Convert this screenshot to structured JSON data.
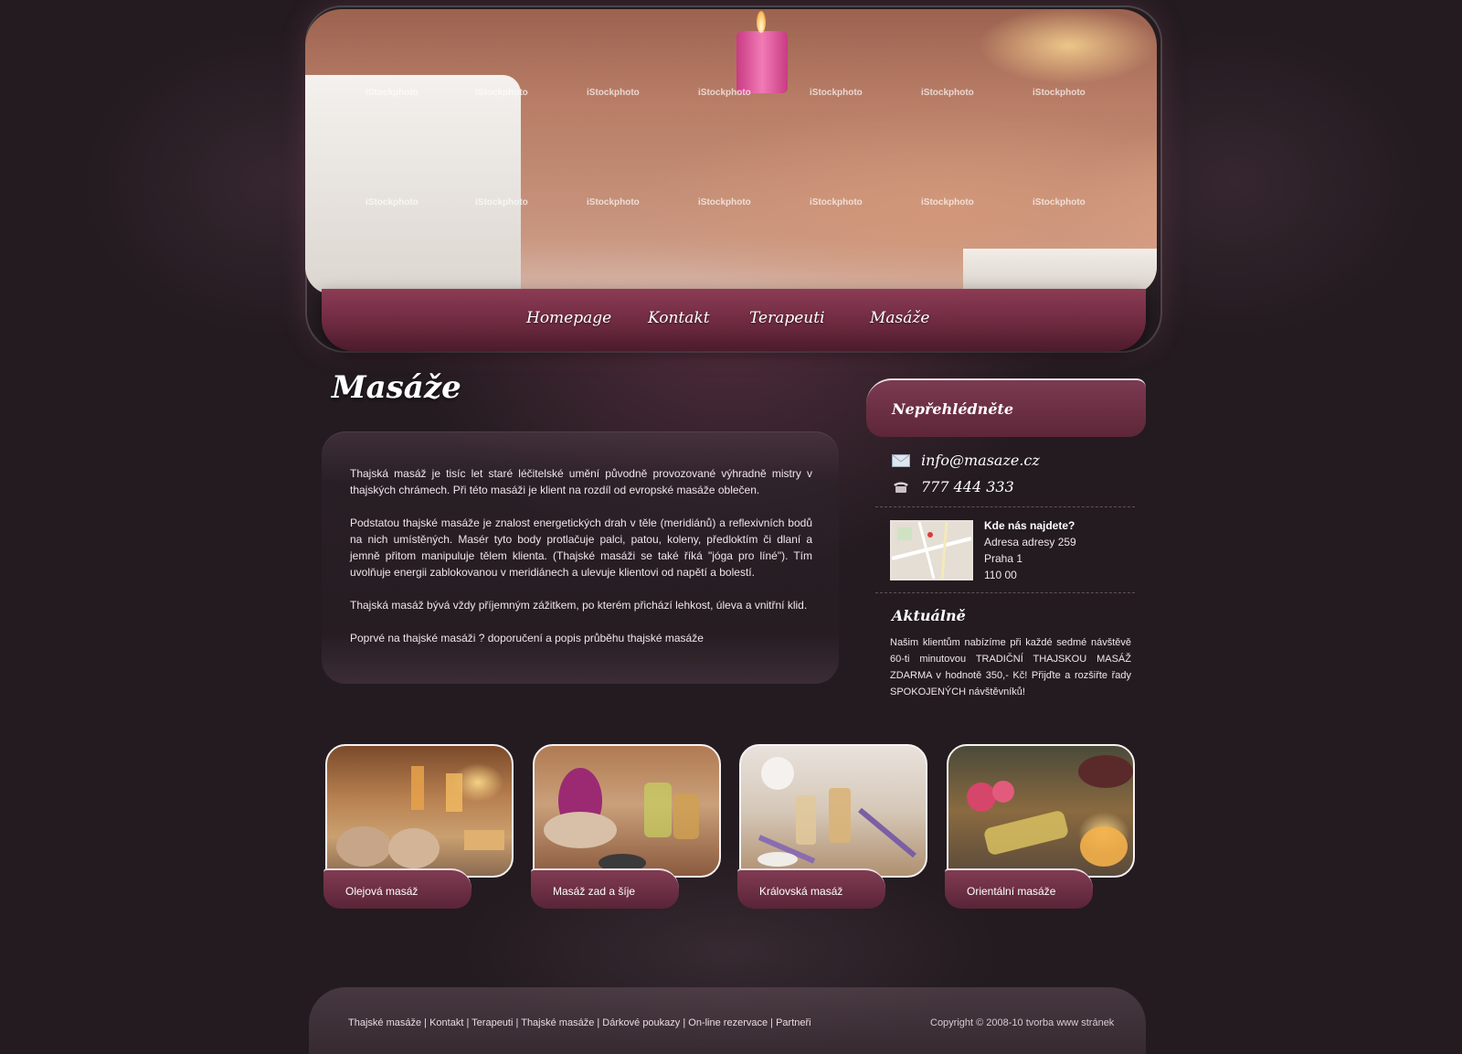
{
  "nav": {
    "items": [
      {
        "label": "Homepage"
      },
      {
        "label": "Kontakt"
      },
      {
        "label": "Terapeuti"
      },
      {
        "label": "Masáže"
      }
    ]
  },
  "hero": {
    "watermark": "iStockphoto"
  },
  "main": {
    "title": "Masáže",
    "paragraphs": [
      "Thajská masáž je tisíc let staré léčitelské umění původně provozované výhradně mistry v thajských chrámech. Při této masáži je klient na rozdíl od evropské masáže oblečen.",
      "Podstatou thajské masáže je znalost energetických drah v těle (meridiánů) a reflexivních bodů na nich umístěných. Masér tyto body protlačuje palci, patou, koleny, předloktím či dlaní a jemně přitom manipuluje tělem klienta. (Thajské masáži se také říká \"jóga pro líné\"). Tím uvolňuje energii zablokovanou v meridiánech a ulevuje klientovi od napětí a bolestí.",
      "Thajská masáž bývá vždy příjemným zážitkem, po kterém přichází lehkost, úleva a vnitřní klid."
    ],
    "link": "Poprvé na thajské masáži ? doporučení a popis průběhu thajské masáže"
  },
  "sidebar": {
    "heading": "Nepřehlédněte",
    "email": "info@masaze.cz",
    "phone": "777 444 333",
    "address": {
      "title": "Kde nás najdete?",
      "line1": "Adresa adresy 259",
      "line2": "Praha 1",
      "line3": "110 00"
    },
    "news": {
      "title": "Aktuálně",
      "text": "Našim klientům nabízíme při každé sedmé návštěvě 60-ti minutovou TRADIČNÍ THAJSKOU MASÁŽ ZDARMA v hodnotě 350,- Kč! Přijďte a rozšiřte řady SPOKOJENÝCH návštěvníků!"
    }
  },
  "cards": [
    {
      "label": "Olejová masáž"
    },
    {
      "label": "Masáž zad a šíje"
    },
    {
      "label": "Královská masáž"
    },
    {
      "label": "Orientální masáže"
    }
  ],
  "footer": {
    "links": [
      "Thajské masáže",
      "Kontakt",
      "Terapeuti",
      "Thajské masáže",
      "Dárkové poukazy",
      "On-line rezervace",
      "Partneři"
    ],
    "separator": " | ",
    "copyright": "Copyright © 2008-10 tvorba www stránek"
  },
  "colors": {
    "background": "#231b20",
    "accent": "#7b3a50",
    "text": "#f0e6ea"
  }
}
